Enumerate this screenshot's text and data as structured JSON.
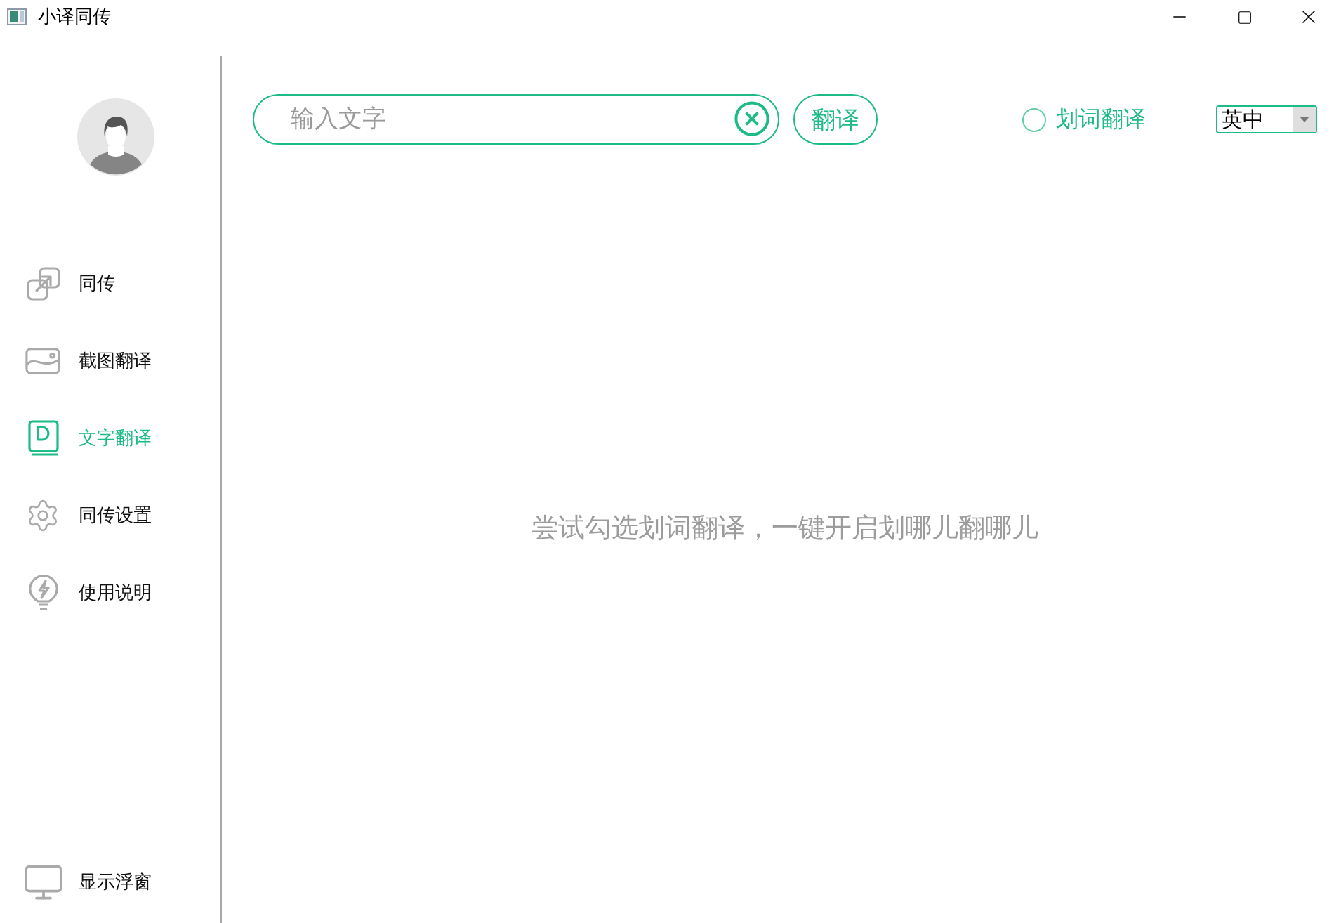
{
  "window": {
    "title": "小译同传"
  },
  "sidebar": {
    "items": [
      {
        "kind": "sync",
        "label": "同传",
        "selected": false
      },
      {
        "kind": "screenshot",
        "label": "截图翻译",
        "selected": false
      },
      {
        "kind": "document",
        "label": "文字翻译",
        "selected": true
      },
      {
        "kind": "settings",
        "label": "同传设置",
        "selected": false
      },
      {
        "kind": "help",
        "label": "使用说明",
        "selected": false
      }
    ],
    "bottom_item": {
      "label": "显示浮窗"
    }
  },
  "toolbar": {
    "search": {
      "placeholder": "输入文字"
    },
    "translate_button": "翻译",
    "word_select": {
      "label": "划词翻译",
      "checked": false
    },
    "language_select": {
      "value": "英中"
    }
  },
  "hint": "尝试勾选划词翻译，一键开启划哪儿翻哪儿"
}
